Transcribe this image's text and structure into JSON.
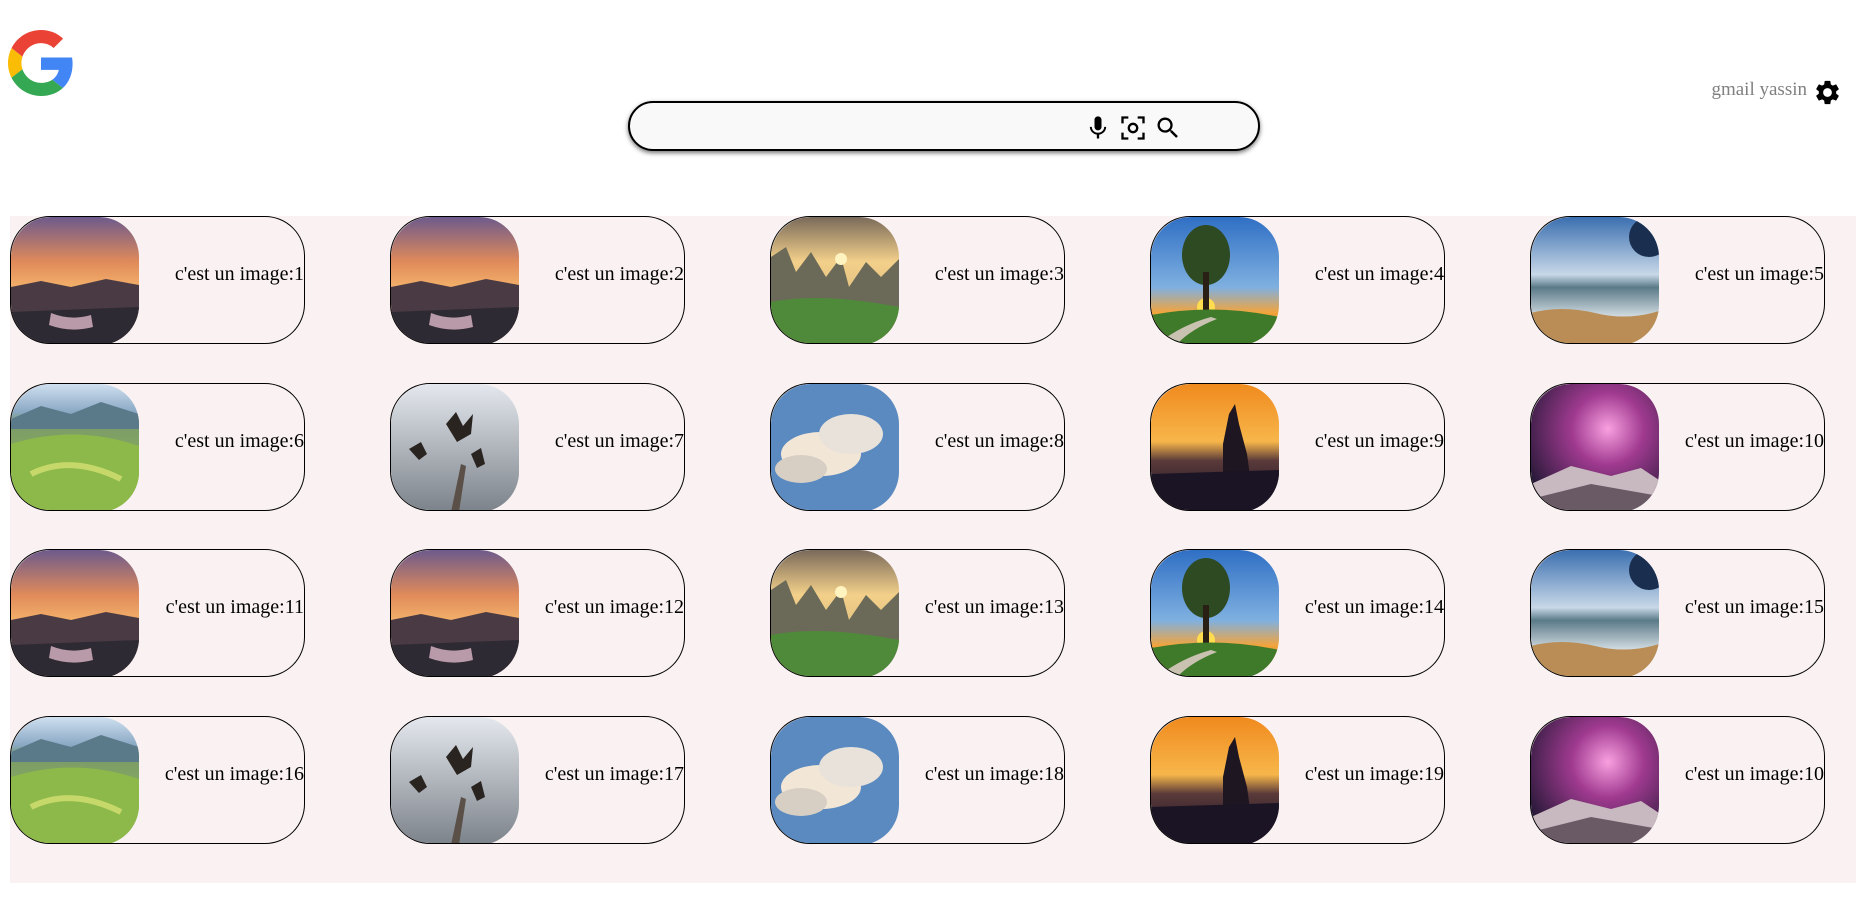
{
  "header": {
    "logo_icon": "google-g-logo",
    "search": {
      "value": "",
      "placeholder": "",
      "icons": [
        "microphone-icon",
        "camera-lens-icon",
        "search-icon"
      ]
    },
    "account_label": "gmail yassin",
    "settings_icon": "gear-icon"
  },
  "colors": {
    "grid_background": "#faf2f2",
    "google_blue": "#4285F4",
    "google_red": "#EA4335",
    "google_yellow": "#FBBC05",
    "google_green": "#34A853"
  },
  "cards": [
    {
      "caption": "c'est un image:1",
      "image": "sunset-canyon-waterfall"
    },
    {
      "caption": "c'est un image:2",
      "image": "sunset-canyon-waterfall"
    },
    {
      "caption": "c'est un image:3",
      "image": "rock-mountains-sunrise"
    },
    {
      "caption": "c'est un image:4",
      "image": "tree-sunset-path"
    },
    {
      "caption": "c'est un image:5",
      "image": "ocean-waves-beach"
    },
    {
      "caption": "c'est un image:6",
      "image": "green-valley"
    },
    {
      "caption": "c'est un image:7",
      "image": "eagles-flying"
    },
    {
      "caption": "c'est un image:8",
      "image": "clouds-blue-sky"
    },
    {
      "caption": "c'est un image:9",
      "image": "rock-spire-sunset"
    },
    {
      "caption": "c'est un image:10",
      "image": "pink-storm-rocks"
    },
    {
      "caption": "c'est un image:11",
      "image": "sunset-canyon-waterfall"
    },
    {
      "caption": "c'est un image:12",
      "image": "sunset-canyon-waterfall"
    },
    {
      "caption": "c'est un image:13",
      "image": "rock-mountains-sunrise"
    },
    {
      "caption": "c'est un image:14",
      "image": "tree-sunset-path"
    },
    {
      "caption": "c'est un image:15",
      "image": "ocean-waves-beach"
    },
    {
      "caption": "c'est un image:16",
      "image": "green-valley"
    },
    {
      "caption": "c'est un image:17",
      "image": "eagles-flying"
    },
    {
      "caption": "c'est un image:18",
      "image": "clouds-blue-sky"
    },
    {
      "caption": "c'est un image:19",
      "image": "rock-spire-sunset"
    },
    {
      "caption": "c'est un image:10",
      "image": "pink-storm-rocks"
    }
  ]
}
